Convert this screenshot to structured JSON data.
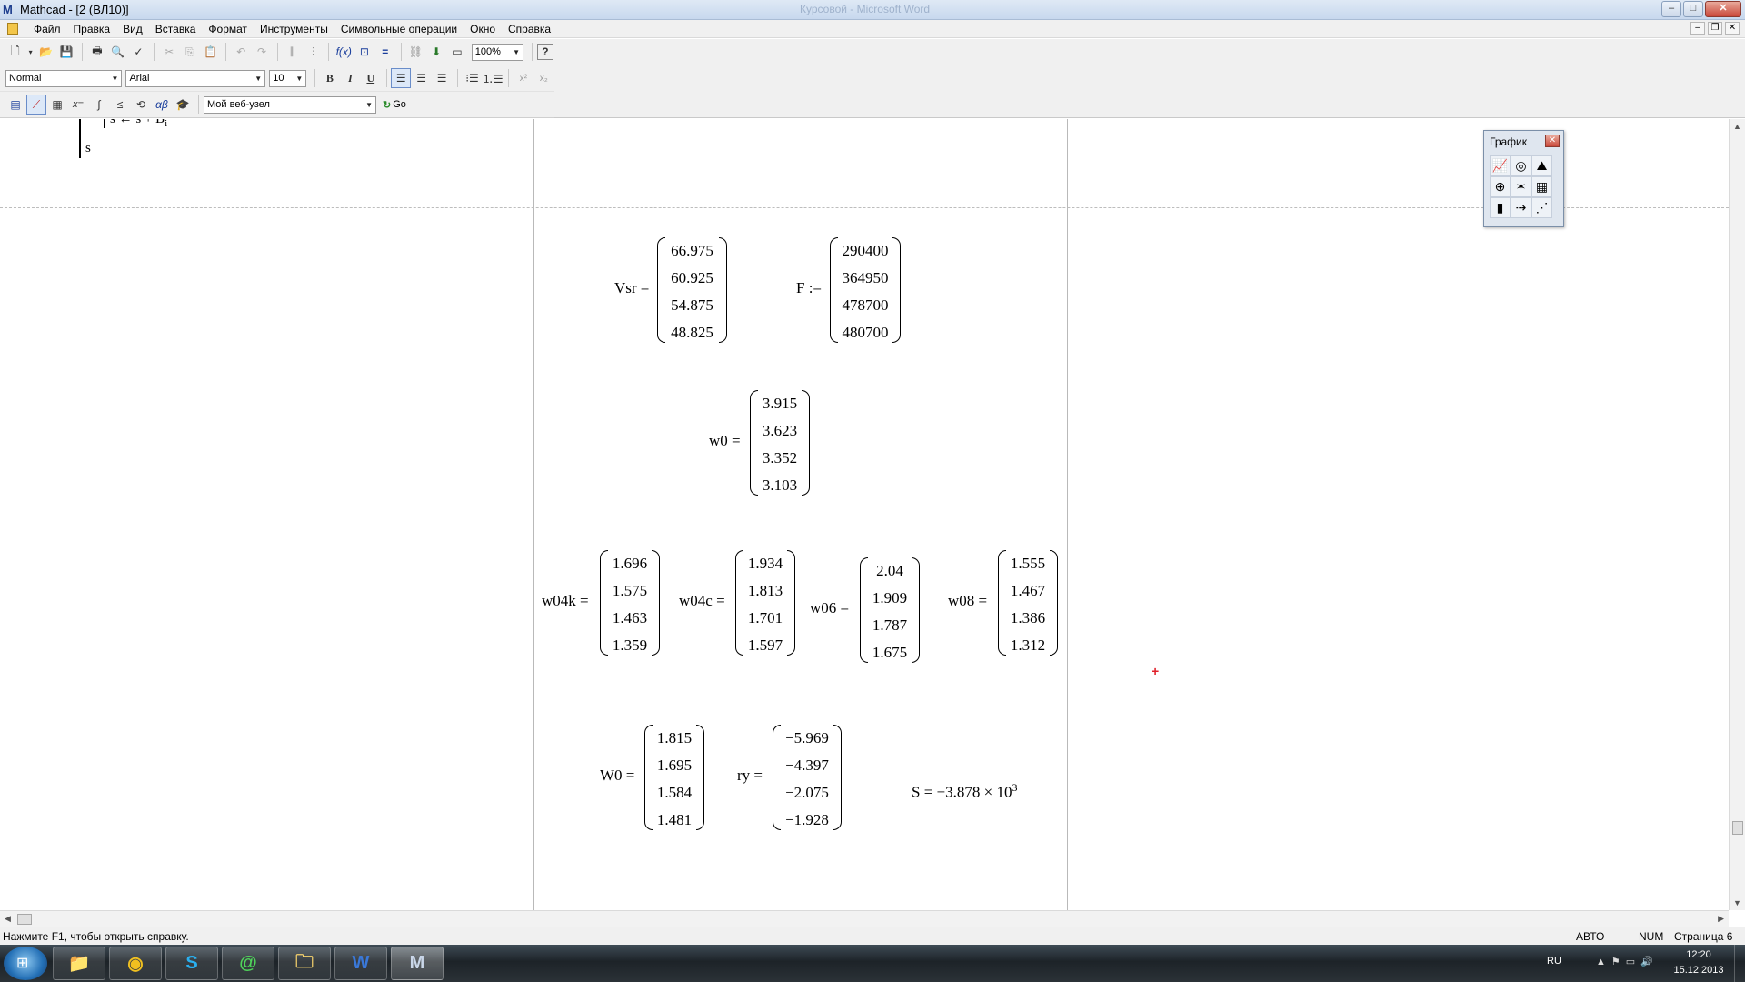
{
  "window": {
    "title": "Mathcad - [2 (ВЛ10)]",
    "ghost_title": "Курсовой - Microsoft Word",
    "min_label": "–",
    "max_label": "□",
    "close_label": "✕"
  },
  "menu": {
    "items": [
      "Файл",
      "Правка",
      "Вид",
      "Вставка",
      "Формат",
      "Инструменты",
      "Символьные операции",
      "Окно",
      "Справка"
    ],
    "mdi_min": "–",
    "mdi_restore": "❐",
    "mdi_close": "✕"
  },
  "toolbar": {
    "zoom_value": "100%",
    "style_value": "Normal",
    "font_value": "Arial",
    "size_value": "10",
    "bold": "B",
    "italic": "I",
    "underline": "U",
    "url_value": "Мой веб-узел",
    "go_label": "Go"
  },
  "worksheet": {
    "top_fragment_1": "s ← s + B",
    "top_fragment_1_sub": "i",
    "top_fragment_2": "s",
    "vsr": {
      "label": "Vsr =",
      "values": [
        "66.975",
        "60.925",
        "54.875",
        "48.825"
      ]
    },
    "F": {
      "label": "F :=",
      "values": [
        "290400",
        "364950",
        "478700",
        "480700"
      ]
    },
    "w0": {
      "label": "w0 =",
      "values": [
        "3.915",
        "3.623",
        "3.352",
        "3.103"
      ]
    },
    "w04k": {
      "label": "w04k =",
      "values": [
        "1.696",
        "1.575",
        "1.463",
        "1.359"
      ]
    },
    "w04c": {
      "label": "w04c =",
      "values": [
        "1.934",
        "1.813",
        "1.701",
        "1.597"
      ]
    },
    "w06": {
      "label": "w06 =",
      "values": [
        "2.04",
        "1.909",
        "1.787",
        "1.675"
      ]
    },
    "w08": {
      "label": "w08 =",
      "values": [
        "1.555",
        "1.467",
        "1.386",
        "1.312"
      ]
    },
    "W0": {
      "label": "W0 =",
      "values": [
        "1.815",
        "1.695",
        "1.584",
        "1.481"
      ]
    },
    "ry": {
      "label": "ry =",
      "values": [
        "−5.969",
        "−4.397",
        "−2.075",
        "−1.928"
      ]
    },
    "S": {
      "label": "S = −3.878 × 10",
      "exponent": "3"
    }
  },
  "palette": {
    "title": "График",
    "close": "✕",
    "icons": [
      "xy-plot-icon",
      "polar-plot-icon",
      "surface-plot-icon",
      "contour-plot-icon",
      "3d-scatter-icon",
      "3d-bar-icon",
      "vector-field-icon",
      "3d-plot-wizard-icon",
      "quickplot-icon"
    ],
    "glyphs": [
      "📈",
      "◎",
      "⛰",
      "⊕",
      "✶",
      "▦",
      "▮",
      "⇢",
      "⋰"
    ]
  },
  "status": {
    "hint": "Нажмите F1, чтобы открыть справку.",
    "auto": "АВТО",
    "num": "NUM",
    "page": "Страница 6"
  },
  "taskbar": {
    "lang": "RU",
    "time": "12:20",
    "date": "15.12.2013",
    "apps": [
      "windows-explorer",
      "chrome",
      "skype",
      "mail-agent",
      "folder",
      "word",
      "mathcad"
    ],
    "app_glyphs": [
      "📁",
      "◉",
      "S",
      "@",
      "🗀",
      "W",
      "M"
    ]
  },
  "colors": {
    "accent_red": "#e0202a",
    "taskbar": "#1d2328",
    "toolbar_bg": "#f0f0f0"
  }
}
